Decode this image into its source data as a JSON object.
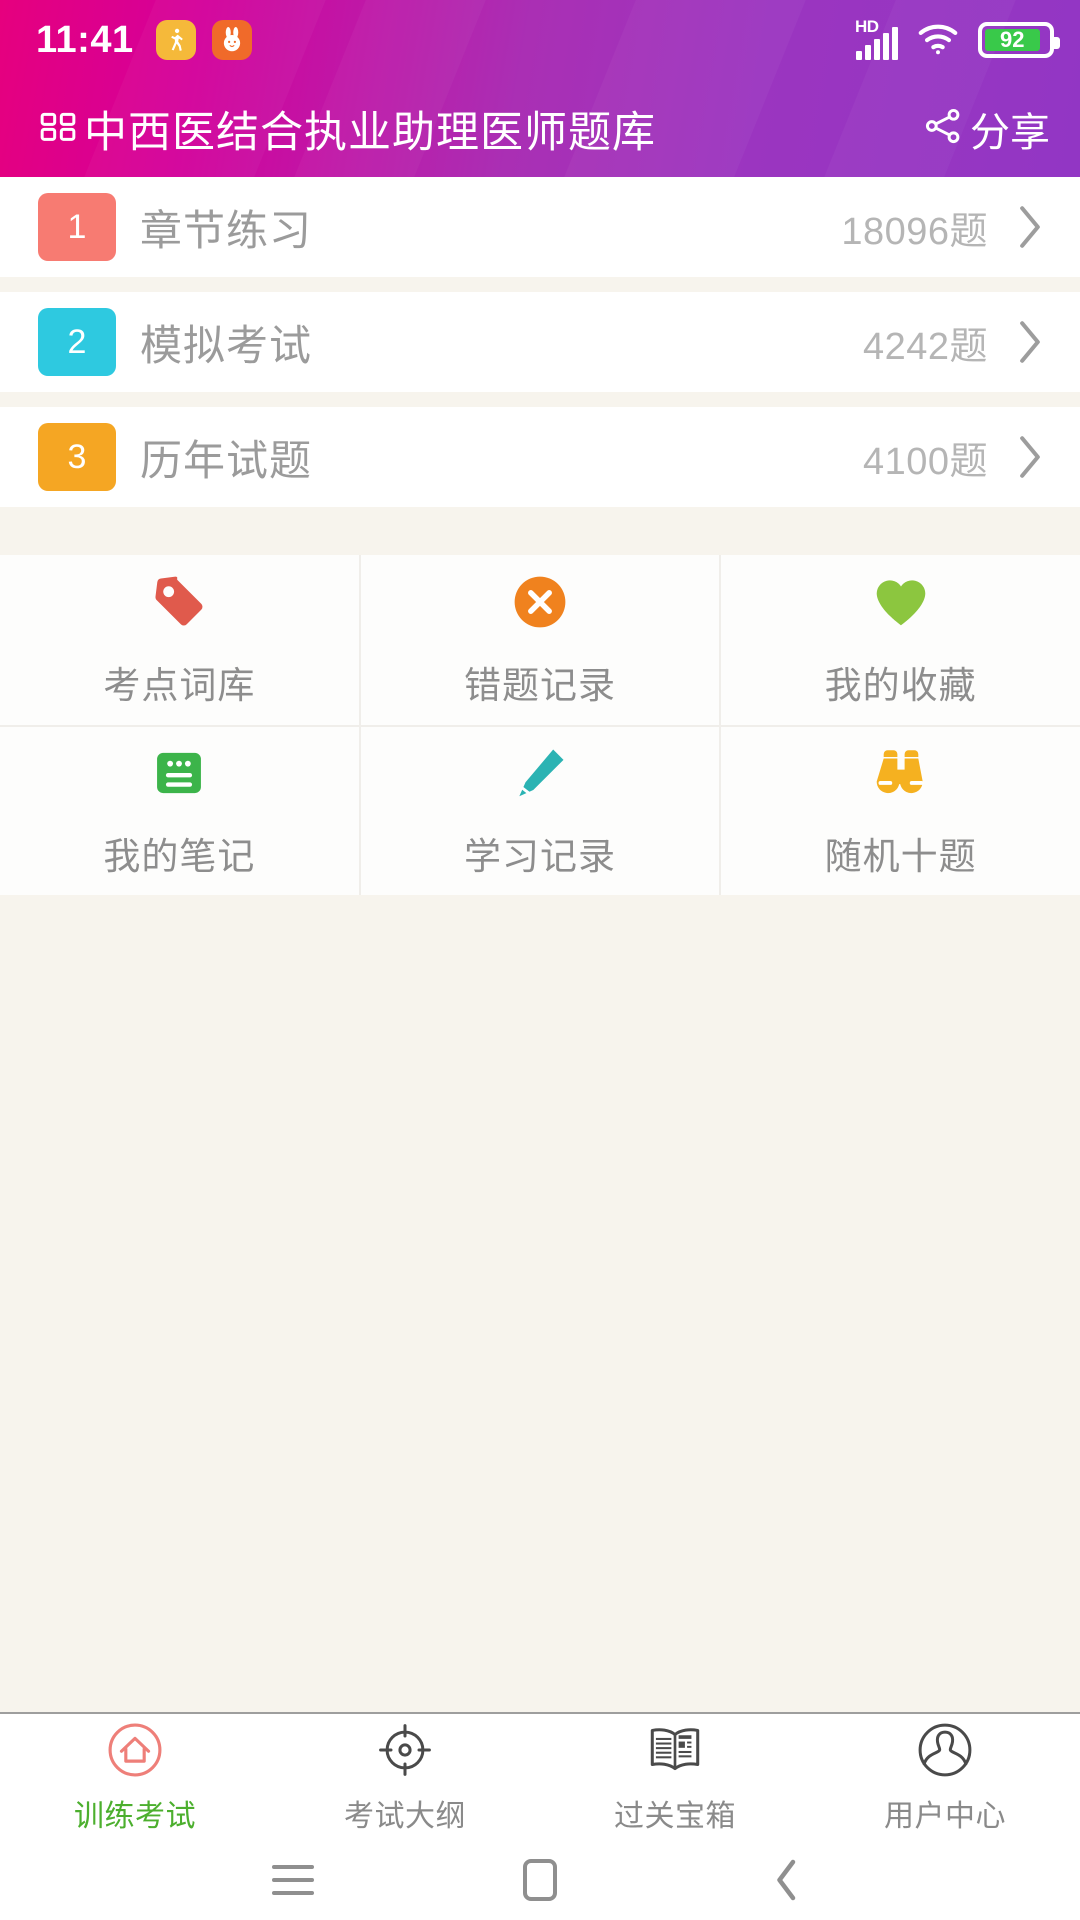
{
  "statusbar": {
    "time": "11:41",
    "notifications": [
      {
        "icon": "pedestrian-icon",
        "glyph": "Ὣ6"
      },
      {
        "icon": "rabbit-app-icon",
        "glyph": "●"
      }
    ],
    "hd_label": "HD",
    "signal_icon": "signal-bars-icon",
    "wifi_icon": "wifi-icon",
    "battery_percent": "92",
    "battery_icon": "battery-icon"
  },
  "header": {
    "menu_icon": "grid-menu-icon",
    "title": "中西医结合执业助理医师题库",
    "share_icon": "share-icon",
    "share_label": "分享",
    "gradient_from": "#e6007e",
    "gradient_to": "#9236c4"
  },
  "menu": {
    "items": [
      {
        "num": "1",
        "label": "章节练习",
        "count": "18096题",
        "color": "#f77b72",
        "chevron": "chevron-right-icon"
      },
      {
        "num": "2",
        "label": "模拟考试",
        "count": "4242题",
        "color": "#2ec9e0",
        "chevron": "chevron-right-icon"
      },
      {
        "num": "3",
        "label": "历年试题",
        "count": "4100题",
        "color": "#f5a623",
        "chevron": "chevron-right-icon"
      }
    ]
  },
  "features": {
    "rows": [
      [
        {
          "label": "考点词库",
          "icon": "price-tag-icon",
          "color": "#e05a4c"
        },
        {
          "label": "错题记录",
          "icon": "error-circle-x-icon",
          "color": "#f0821e"
        },
        {
          "label": "我的收藏",
          "icon": "heart-icon",
          "color": "#8cc63f"
        }
      ],
      [
        {
          "label": "我的笔记",
          "icon": "note-icon",
          "color": "#3cb44a"
        },
        {
          "label": "学习记录",
          "icon": "pencil-icon",
          "color": "#2bb3b3"
        },
        {
          "label": "随机十题",
          "icon": "binoculars-icon",
          "color": "#f5b120"
        }
      ]
    ]
  },
  "tabbar": {
    "active_color": "#4caf2e",
    "tabs": [
      {
        "label": "训练考试",
        "icon": "home-circle-icon",
        "active": true
      },
      {
        "label": "考试大纲",
        "icon": "target-crosshair-icon",
        "active": false
      },
      {
        "label": "过关宝箱",
        "icon": "newspaper-icon",
        "active": false
      },
      {
        "label": "用户中心",
        "icon": "user-circle-icon",
        "active": false
      }
    ]
  },
  "sysnav": {
    "buttons": [
      {
        "icon": "menu-recents-icon"
      },
      {
        "icon": "home-square-icon"
      },
      {
        "icon": "back-chevron-icon"
      }
    ]
  }
}
